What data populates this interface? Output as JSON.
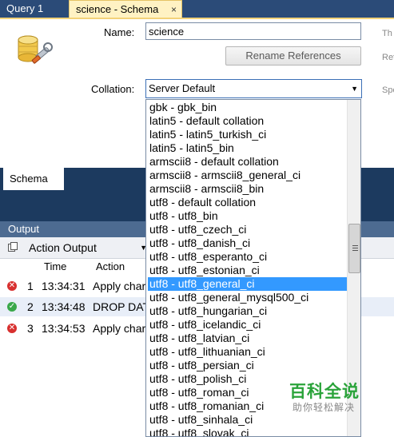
{
  "tabs": {
    "query_tab": "Query 1",
    "schema_tab": "science - Schema",
    "close_glyph": "×"
  },
  "editor": {
    "name_label": "Name:",
    "name_value": "science",
    "rename_button": "Rename References",
    "collation_label": "Collation:",
    "collation_value": "Server Default",
    "side_text_1": "Th",
    "side_text_2": "Ref",
    "side_text_3": "Spe",
    "schema_subtab": "Schema"
  },
  "collation_options": [
    "gbk - gbk_bin",
    "latin5 - default collation",
    "latin5 - latin5_turkish_ci",
    "latin5 - latin5_bin",
    "armscii8 - default collation",
    "armscii8 - armscii8_general_ci",
    "armscii8 - armscii8_bin",
    "utf8 - default collation",
    "utf8 - utf8_bin",
    "utf8 - utf8_czech_ci",
    "utf8 - utf8_danish_ci",
    "utf8 - utf8_esperanto_ci",
    "utf8 - utf8_estonian_ci",
    "utf8 - utf8_general_ci",
    "utf8 - utf8_general_mysql500_ci",
    "utf8 - utf8_hungarian_ci",
    "utf8 - utf8_icelandic_ci",
    "utf8 - utf8_latvian_ci",
    "utf8 - utf8_lithuanian_ci",
    "utf8 - utf8_persian_ci",
    "utf8 - utf8_polish_ci",
    "utf8 - utf8_roman_ci",
    "utf8 - utf8_romanian_ci",
    "utf8 - utf8_sinhala_ci",
    "utf8 - utf8_slovak_ci"
  ],
  "selected_option": "utf8 - utf8_general_ci",
  "output": {
    "header": "Output",
    "kind": "Action Output",
    "columns": {
      "time": "Time",
      "action": "Action"
    },
    "rows": [
      {
        "idx": "1",
        "time": "13:34:31",
        "action": "Apply char",
        "status": "error"
      },
      {
        "idx": "2",
        "time": "13:34:48",
        "action": "DROP DAT",
        "status": "ok"
      },
      {
        "idx": "3",
        "time": "13:34:53",
        "action": "Apply char",
        "status": "error"
      }
    ]
  },
  "watermark": {
    "title": "百科全说",
    "subtitle": "助你轻松解决"
  },
  "colors": {
    "selection": "#3399ff",
    "error": "#d8302f",
    "ok": "#3aa84a",
    "tab_active": "#fff2c3"
  }
}
